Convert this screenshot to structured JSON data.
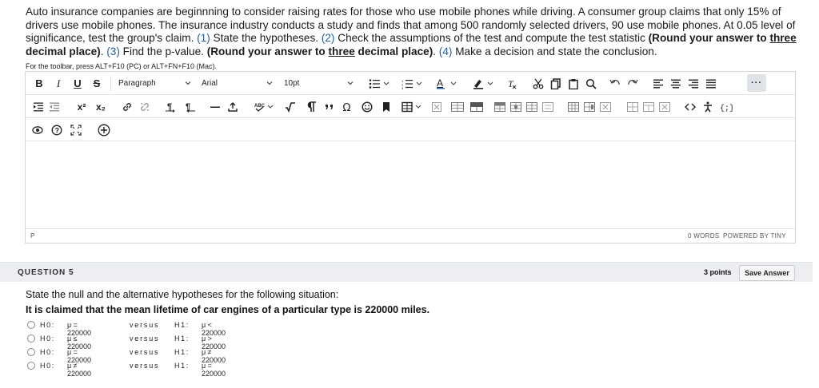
{
  "prompt": {
    "p1": "Auto insurance companies are beginnning to consider raising rates for those who use mobile phones while driving. A consumer group claims that only 15% of drivers use mobile phones. The insurance industry conducts a study and finds that among 500 randomly selected drivers, 90 use mobile phones. At 0.05 level of significance, test the group's claim. ",
    "n1": "(1)",
    "s1": " State the hypotheses. ",
    "n2": "(2)",
    "s2": " Check the assumptions of the test and compute the test statistic ",
    "b1": "(Round your answer to ",
    "u1": "three",
    "b2": " decimal place)",
    "s3": ". ",
    "n3": "(3)",
    "s4": " Find the p-value. ",
    "b3": "(Round your answer to ",
    "u2": "three",
    "b4": " decimal place)",
    "s5": ". ",
    "n4": "(4)",
    "s6": " Make a decision and state the conclusion."
  },
  "hint": "For the toolbar, press ALT+F10 (PC) or ALT+FN+F10 (Mac).",
  "toolbar": {
    "bold": "B",
    "italic": "I",
    "underline": "U",
    "strike": "S",
    "paragraph": "Paragraph",
    "font": "Arial",
    "size": "10pt",
    "superscript": "x²",
    "subscript": "x₂",
    "more": "···"
  },
  "statusbar": {
    "path": "P",
    "words": "0 WORDS",
    "powered": "POWERED BY TINY"
  },
  "question": {
    "label": "QUESTION 5",
    "points": "3 points",
    "save": "Save Answer",
    "text": "State  the null and the alternative hypotheses for the following situation:",
    "claim": "It is claimed that the mean lifetime of car engines of a particular type is  220000 miles."
  },
  "options": [
    {
      "h0": "H0:",
      "h0val": "μ = 220000",
      "versus": "versus",
      "h1": "H1:",
      "h1val": "μ < 220000"
    },
    {
      "h0": "H0:",
      "h0val": "μ ≤ 220000",
      "versus": "versus",
      "h1": "H1:",
      "h1val": "μ > 220000"
    },
    {
      "h0": "H0:",
      "h0val": "μ = 220000",
      "versus": "versus",
      "h1": "H1:",
      "h1val": "μ ≠ 220000"
    },
    {
      "h0": "H0:",
      "h0val": "μ ≠ 220000",
      "versus": "versus",
      "h1": "H1:",
      "h1val": "μ = 220000"
    }
  ],
  "colors": {
    "accent_blue": "#1f5fa8",
    "toolbar_blue": "#1f6fc4"
  }
}
